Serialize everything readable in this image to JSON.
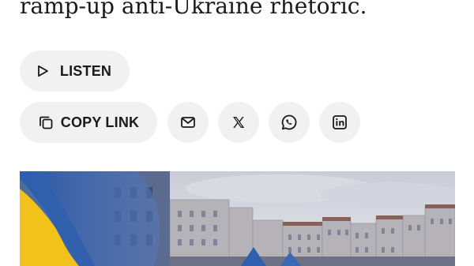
{
  "article": {
    "headline_fragment": "ramp-up anti-Ukraine rhetoric."
  },
  "actions": {
    "listen_label": "LISTEN",
    "copy_link_label": "COPY LINK"
  },
  "share": {
    "icons": [
      "envelope-icon",
      "x-logo-icon",
      "whatsapp-icon",
      "linkedin-icon"
    ]
  },
  "photo": {
    "subject": "ukraine-flag-city-square"
  },
  "colors": {
    "button_bg": "#f1f1f1",
    "text": "#1a1a1a",
    "flag_blue": "#2f5fae",
    "flag_yellow": "#f2c21b"
  }
}
